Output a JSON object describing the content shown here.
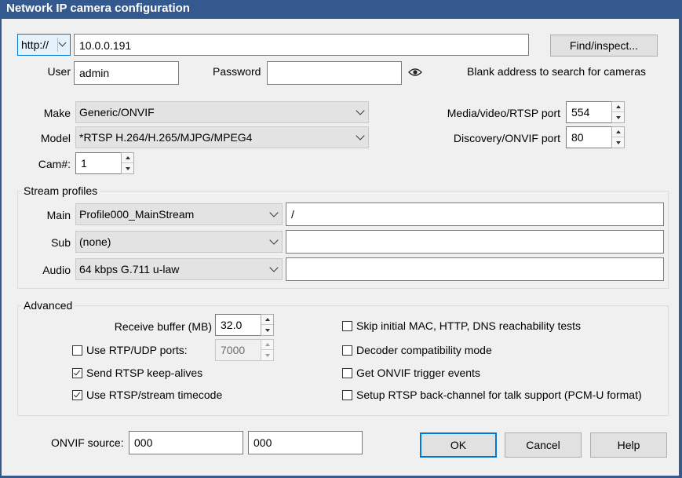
{
  "window": {
    "title": "Network IP camera configuration"
  },
  "connection": {
    "protocol": "http://",
    "address": "10.0.0.191",
    "find_button": "Find/inspect...",
    "user_label": "User",
    "user_value": "admin",
    "password_label": "Password",
    "password_value": "",
    "hint": "Blank address to search for cameras"
  },
  "camera": {
    "make_label": "Make",
    "make_value": "Generic/ONVIF",
    "model_label": "Model",
    "model_value": "*RTSP H.264/H.265/MJPG/MPEG4",
    "cam_label": "Cam#:",
    "cam_value": "1",
    "media_port_label": "Media/video/RTSP port",
    "media_port_value": "554",
    "discovery_port_label": "Discovery/ONVIF port",
    "discovery_port_value": "80"
  },
  "stream_profiles": {
    "title": "Stream profiles",
    "rows": [
      {
        "label": "Main",
        "profile": "Profile000_MainStream",
        "path": "/"
      },
      {
        "label": "Sub",
        "profile": "(none)",
        "path": ""
      },
      {
        "label": "Audio",
        "profile": "64 kbps G.711 u-law",
        "path": ""
      }
    ]
  },
  "advanced": {
    "title": "Advanced",
    "receive_buffer_label": "Receive buffer (MB)",
    "receive_buffer_value": "32.0",
    "rtp_udp_label": "Use RTP/UDP ports:",
    "rtp_udp_checked": false,
    "rtp_udp_value": "7000",
    "keepalive_label": "Send RTSP keep-alives",
    "keepalive_checked": true,
    "timecode_label": "Use RTSP/stream timecode",
    "timecode_checked": true,
    "skip_tests_label": "Skip initial MAC, HTTP, DNS reachability tests",
    "skip_tests_checked": false,
    "decoder_compat_label": "Decoder compatibility mode",
    "decoder_compat_checked": false,
    "onvif_trigger_label": "Get ONVIF trigger events",
    "onvif_trigger_checked": false,
    "backchannel_label": "Setup RTSP back-channel for talk support (PCM-U format)",
    "backchannel_checked": false
  },
  "onvif_source": {
    "label": "ONVIF source:",
    "value1": "000",
    "value2": "000"
  },
  "buttons": {
    "ok": "OK",
    "cancel": "Cancel",
    "help": "Help"
  },
  "colors": {
    "titlebar": "#34598f",
    "focus": "#0078d7",
    "dialog_bg": "#f0f0f0"
  }
}
